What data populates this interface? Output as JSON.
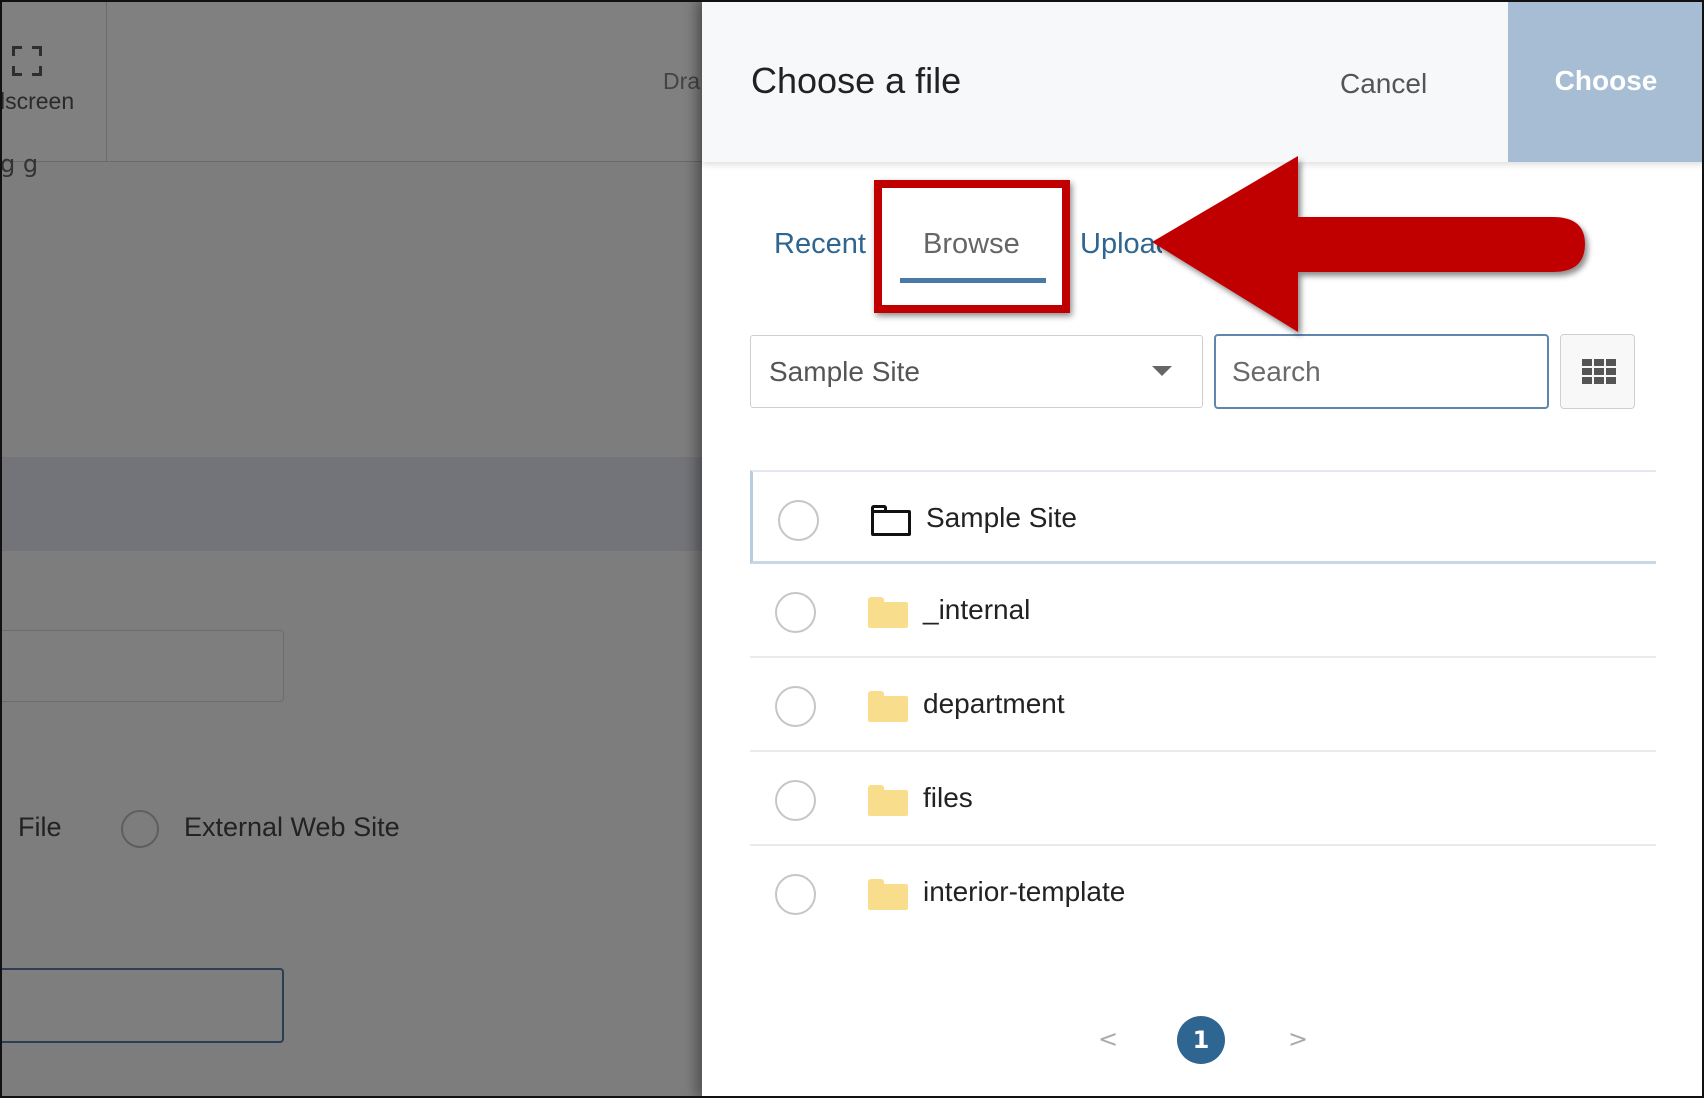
{
  "background": {
    "fullscreen_label": "lscreen",
    "draft_label": "Dra",
    "squiggle_text": "g g",
    "file_option_label": "File",
    "external_option_label": "External Web Site"
  },
  "modal": {
    "title": "Choose a file",
    "cancel_label": "Cancel",
    "choose_label": "Choose",
    "tabs": [
      {
        "label": "Recent",
        "active": false
      },
      {
        "label": "Browse",
        "active": true
      },
      {
        "label": "Upload",
        "active": false
      }
    ],
    "site_select_value": "Sample Site",
    "search_placeholder": "Search",
    "files": [
      {
        "name": "Sample Site",
        "icon": "folder-outline-icon"
      },
      {
        "name": "_internal",
        "icon": "folder-icon"
      },
      {
        "name": "department",
        "icon": "folder-icon"
      },
      {
        "name": "files",
        "icon": "folder-icon"
      },
      {
        "name": "interior-template",
        "icon": "folder-icon"
      }
    ],
    "pagination": {
      "prev": "<",
      "current_page": "1",
      "next": ">"
    }
  },
  "colors": {
    "accent": "#2f6591",
    "choose_button": "#a6bdd3",
    "annotation_red": "#c00000",
    "folder_yellow": "#f7dd8c"
  }
}
